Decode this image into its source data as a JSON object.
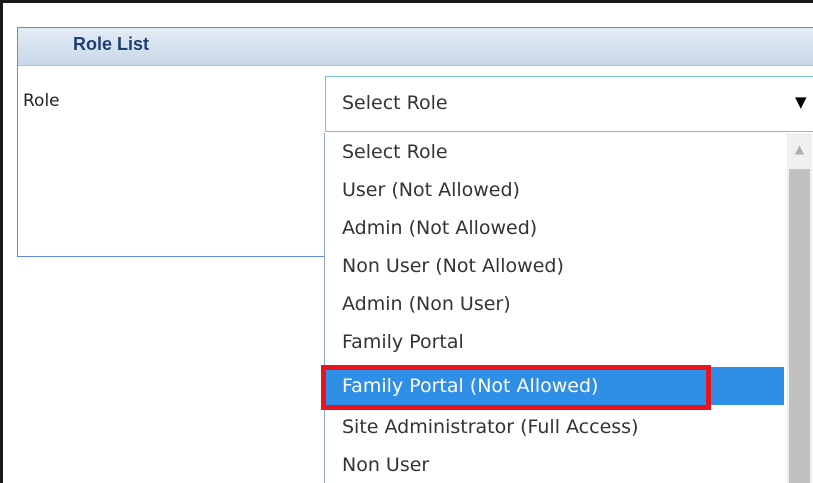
{
  "panel": {
    "title": "Role List"
  },
  "form": {
    "role_label": "Role"
  },
  "role_select": {
    "value": "Select Role",
    "arrow_icon": "triangle-down-icon",
    "options": [
      "Select Role",
      "User (Not Allowed)",
      "Admin (Not Allowed)",
      "Non User (Not Allowed)",
      "Admin (Non User)",
      "Family Portal",
      "Family Portal (Not Allowed)",
      "Site Administrator (Full Access)",
      "Non User"
    ],
    "highlighted_option": "Family Portal (Not Allowed)"
  },
  "colors": {
    "panel_border": "#5b8fd2",
    "header_title": "#1f3f74",
    "selected_option_bg": "#2f8ee5",
    "annotation_box": "#e8131d"
  }
}
